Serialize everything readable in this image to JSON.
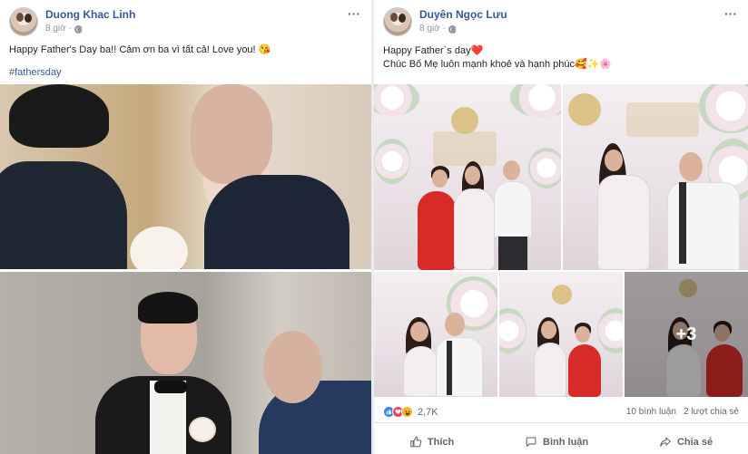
{
  "left_post": {
    "author": "Duong Khac Linh",
    "time": "8 giờ",
    "text": "Happy Father's Day ba!! Cảm ơn ba vì tất cả! Love you! 😘",
    "hashtag": "#fathersday",
    "more": "···"
  },
  "right_post": {
    "author": "Duyên Ngọc Lưu",
    "time": "8 giờ",
    "line1": "Happy Father`s day❤️",
    "line2": "Chúc Bố Mẹ luôn mạnh khoẻ và hạnh phúc🥰✨🌸",
    "more": "···",
    "extra_photos": "+3",
    "reactions_count": "2,7K",
    "comments": "10 bình luận",
    "shares": "2 lượt chia sẻ",
    "like_label": "Thích",
    "comment_label": "Bình luận",
    "share_label": "Chia sẻ"
  },
  "colors": {
    "link": "#385898",
    "muted": "#606770",
    "like": "#2d88ff",
    "love": "#f33e58",
    "haha": "#f7b125"
  }
}
